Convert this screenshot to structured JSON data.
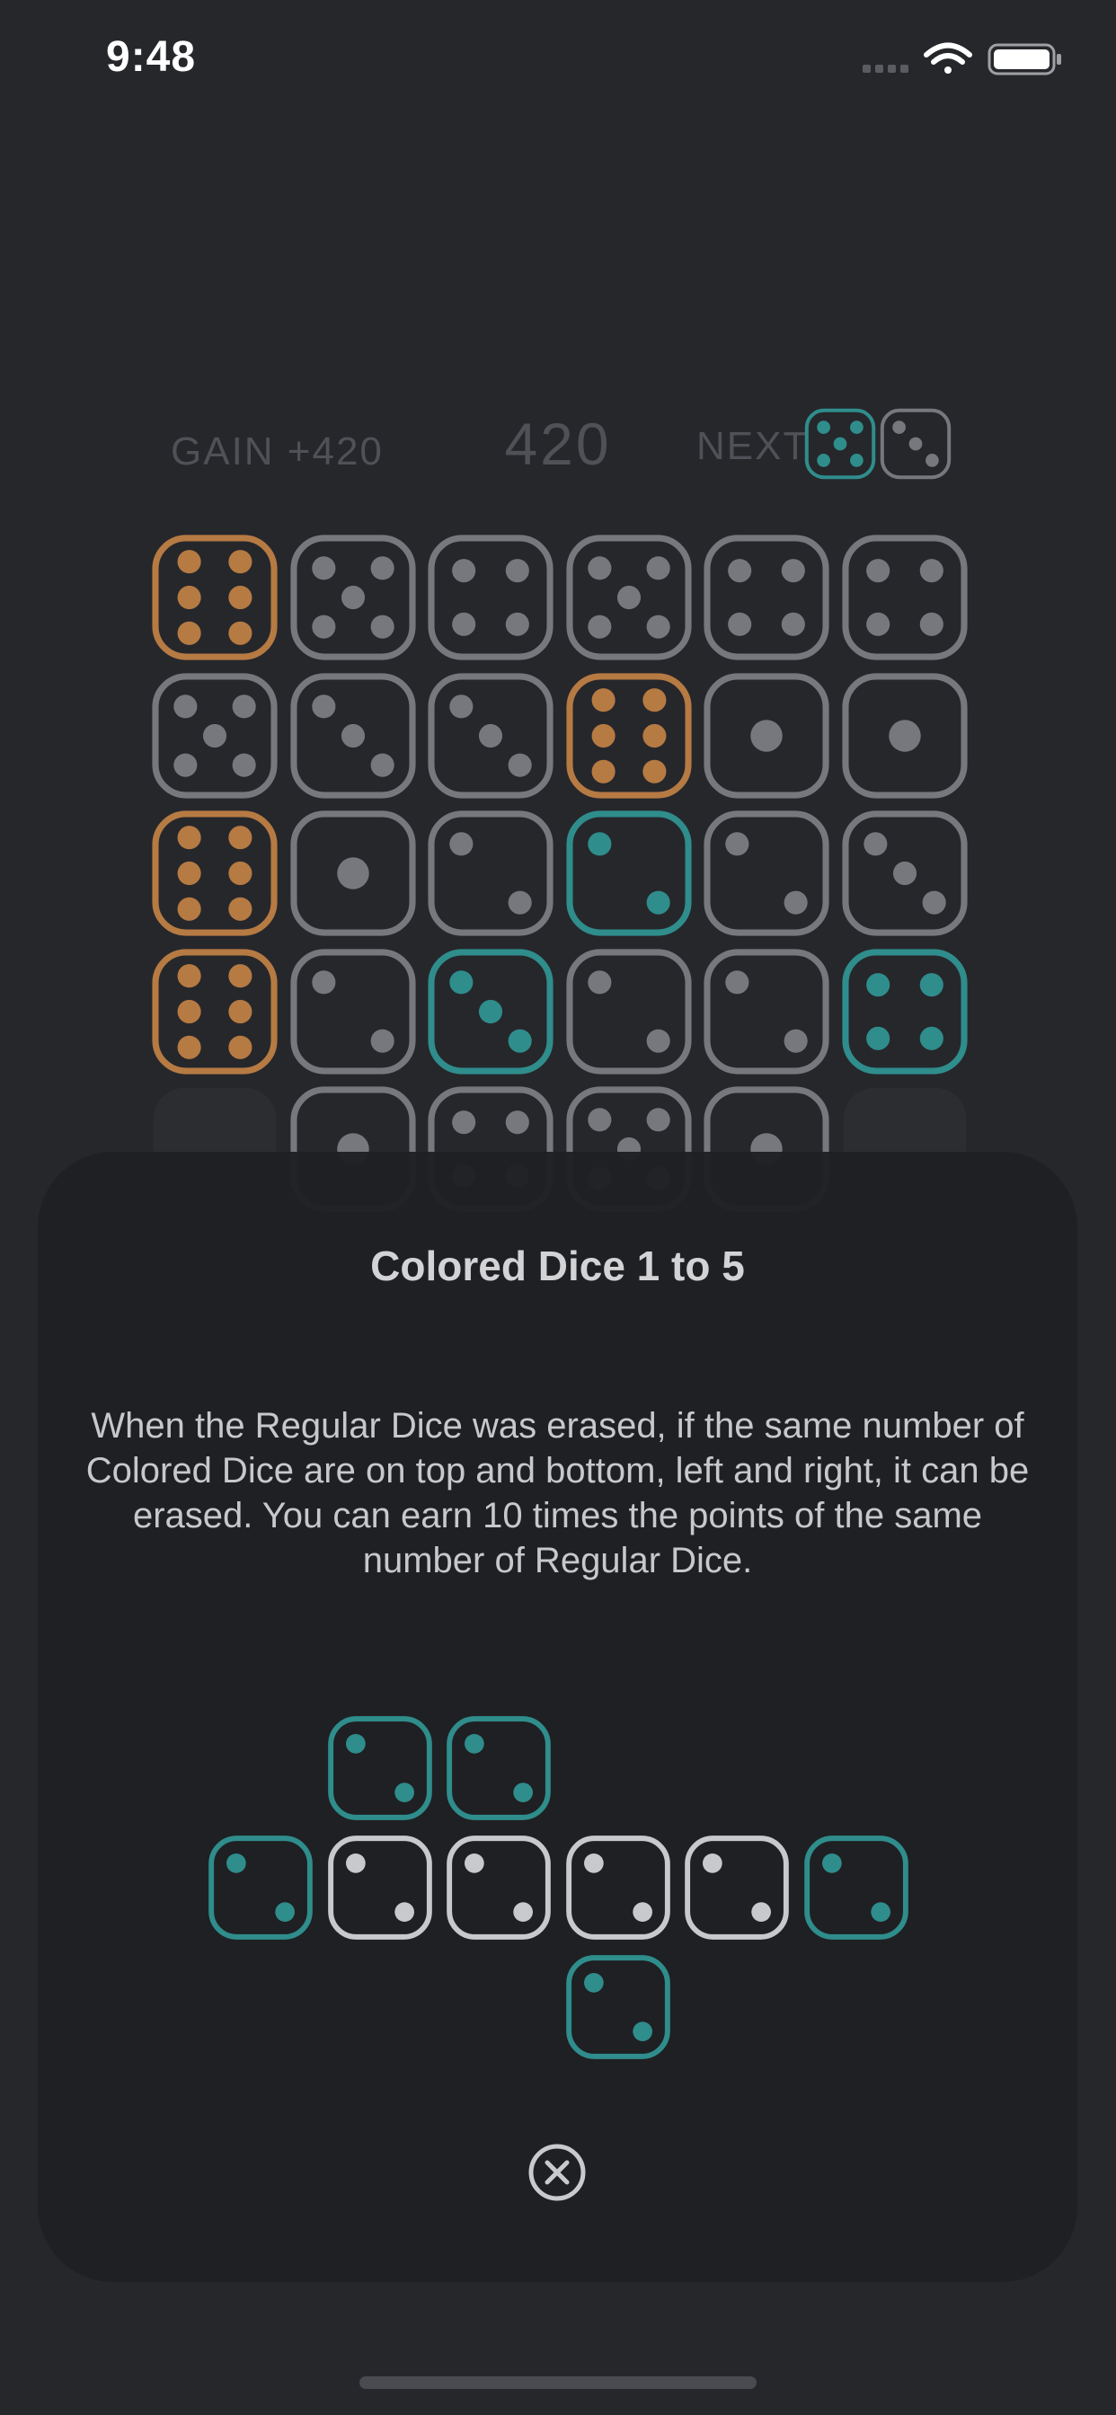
{
  "status_bar": {
    "time": "9:48"
  },
  "header": {
    "gain": "GAIN +420",
    "score": "420",
    "next_label": "NEXT",
    "next_dice": [
      {
        "value": 5,
        "kind": "colored"
      },
      {
        "value": 3,
        "kind": "regular"
      }
    ]
  },
  "board": {
    "rows": [
      [
        {
          "value": 6,
          "kind": "orange"
        },
        {
          "value": 5,
          "kind": "regular"
        },
        {
          "value": 4,
          "kind": "regular"
        },
        {
          "value": 5,
          "kind": "regular"
        },
        {
          "value": 4,
          "kind": "regular"
        },
        {
          "value": 4,
          "kind": "regular"
        }
      ],
      [
        {
          "value": 5,
          "kind": "regular"
        },
        {
          "value": 3,
          "kind": "regular"
        },
        {
          "value": 3,
          "kind": "regular"
        },
        {
          "value": 6,
          "kind": "orange"
        },
        {
          "value": 1,
          "kind": "regular"
        },
        {
          "value": 1,
          "kind": "regular"
        }
      ],
      [
        {
          "value": 6,
          "kind": "orange"
        },
        {
          "value": 1,
          "kind": "regular"
        },
        {
          "value": 2,
          "kind": "regular"
        },
        {
          "value": 2,
          "kind": "teal"
        },
        {
          "value": 2,
          "kind": "regular"
        },
        {
          "value": 3,
          "kind": "regular"
        }
      ],
      [
        {
          "value": 6,
          "kind": "orange"
        },
        {
          "value": 2,
          "kind": "regular"
        },
        {
          "value": 3,
          "kind": "teal"
        },
        {
          "value": 2,
          "kind": "regular"
        },
        {
          "value": 2,
          "kind": "regular"
        },
        {
          "value": 4,
          "kind": "teal"
        }
      ],
      [
        {
          "value": 0,
          "kind": "empty"
        },
        {
          "value": 1,
          "kind": "regular"
        },
        {
          "value": 4,
          "kind": "regular"
        },
        {
          "value": 5,
          "kind": "regular"
        },
        {
          "value": 1,
          "kind": "regular"
        },
        {
          "value": 0,
          "kind": "empty"
        }
      ]
    ]
  },
  "help": {
    "title": "Colored Dice 1 to 5",
    "body": "When the Regular Dice was erased, if the same number of Colored Dice are on top and bottom, left and right, it can be erased. You can earn 10 times the points of the same number of Regular Dice.",
    "example": {
      "top": [
        {
          "value": 2,
          "kind": "teal"
        },
        {
          "value": 2,
          "kind": "teal"
        }
      ],
      "middle": [
        {
          "value": 2,
          "kind": "teal"
        },
        {
          "value": 2,
          "kind": "white"
        },
        {
          "value": 2,
          "kind": "white"
        },
        {
          "value": 2,
          "kind": "white"
        },
        {
          "value": 2,
          "kind": "white"
        },
        {
          "value": 2,
          "kind": "teal"
        }
      ],
      "bottom": [
        {
          "value": 2,
          "kind": "teal"
        }
      ]
    },
    "close_icon": "close-circle-icon"
  },
  "colors": {
    "background": "#26272b",
    "regular_die": "#77787d",
    "orange_die": "#b67a43",
    "teal_die": "#2f8d8c",
    "example_teal": "#3fc6c2",
    "example_white": "#c8c9cc"
  }
}
